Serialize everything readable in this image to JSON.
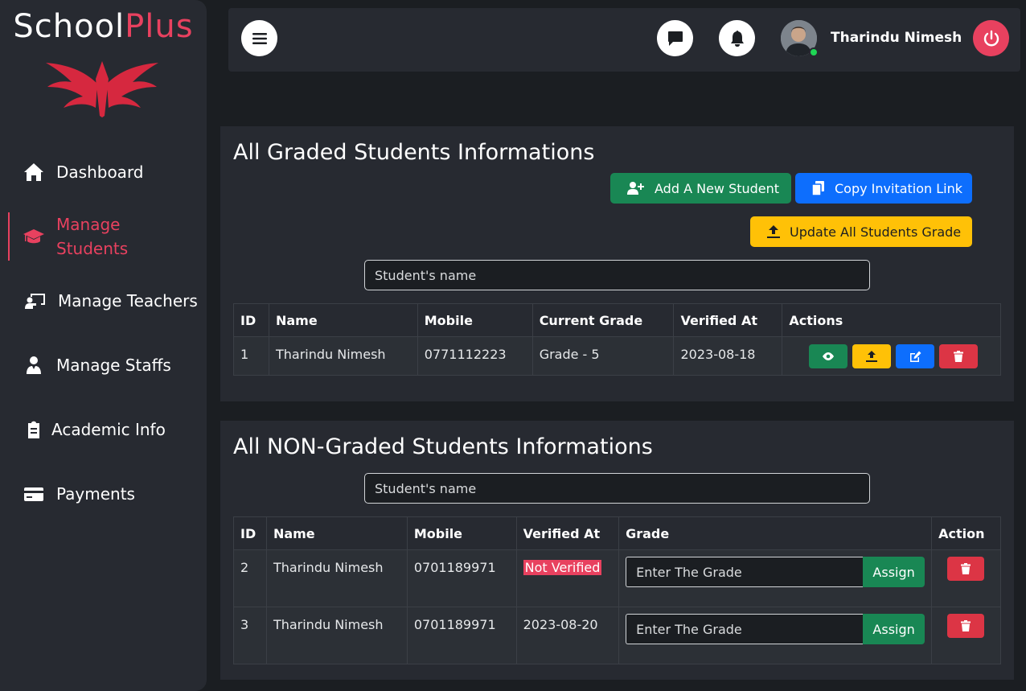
{
  "brand": {
    "name_part1": "School",
    "name_part2": "Plus"
  },
  "sidebar": {
    "items": [
      {
        "label": "Dashboard",
        "icon": "home-icon"
      },
      {
        "label": "Manage Students",
        "icon": "graduation-cap-icon",
        "active": true
      },
      {
        "label": "Manage Teachers",
        "icon": "chalkboard-teacher-icon"
      },
      {
        "label": "Manage Staffs",
        "icon": "user-tie-icon"
      },
      {
        "label": "Academic Info",
        "icon": "clipboard-icon"
      },
      {
        "label": "Payments",
        "icon": "credit-card-icon"
      }
    ]
  },
  "header": {
    "user_name": "Tharindu Nimesh"
  },
  "graded": {
    "title": "All Graded Students Informations",
    "add_button": "Add A New Student",
    "copy_button": "Copy Invitation Link",
    "update_button": "Update All Students Grade",
    "search_placeholder": "Student's name",
    "columns": [
      "ID",
      "Name",
      "Mobile",
      "Current Grade",
      "Verified At",
      "Actions"
    ],
    "rows": [
      {
        "id": "1",
        "name": "Tharindu Nimesh",
        "mobile": "0771112223",
        "grade": "Grade - 5",
        "verified": "2023-08-18"
      }
    ]
  },
  "nongraded": {
    "title": "All NON-Graded Students Informations",
    "search_placeholder": "Student's name",
    "columns": [
      "ID",
      "Name",
      "Mobile",
      "Verified At",
      "Grade",
      "Action"
    ],
    "grade_placeholder": "Enter The Grade",
    "assign_label": "Assign",
    "rows": [
      {
        "id": "2",
        "name": "Tharindu Nimesh",
        "mobile": "0701189971",
        "verified": "Not Verified"
      },
      {
        "id": "3",
        "name": "Tharindu Nimesh",
        "mobile": "0701189971",
        "verified": "2023-08-20"
      }
    ]
  },
  "colors": {
    "accent": "#e8415f",
    "success": "#198754",
    "primary": "#0d6efd",
    "warning": "#ffc107",
    "danger": "#dc3545"
  }
}
